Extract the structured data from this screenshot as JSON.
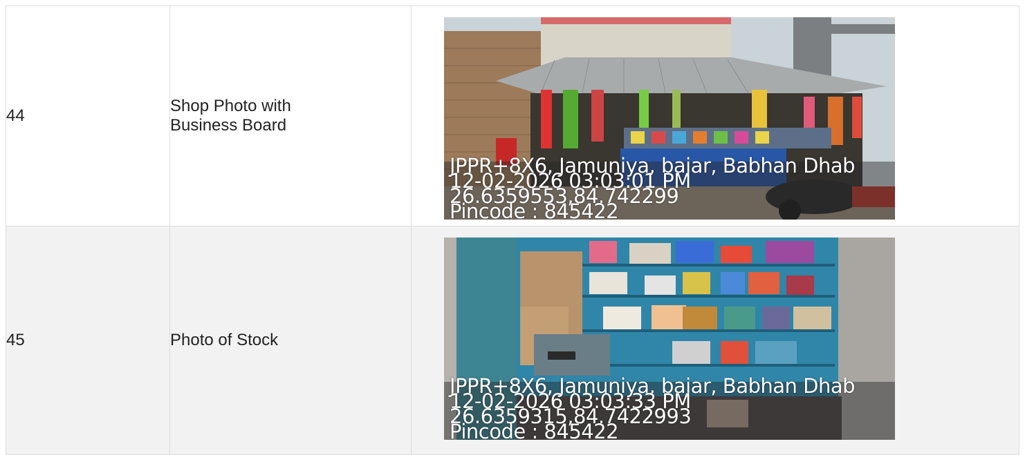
{
  "rows": [
    {
      "number": "44",
      "label": "Shop Photo with Business Board",
      "photo": {
        "icon": "shop-front-photo",
        "stamp": [
          "JPPR+8X6, Jamuniya, bajar, Babhan Dhab",
          "12-02-2026 03:03:01 PM",
          "26.6359553,84.742299",
          "Pincode : 845422"
        ]
      }
    },
    {
      "number": "45",
      "label": "Photo of Stock",
      "photo": {
        "icon": "shop-stock-photo",
        "stamp": [
          "JPPR+8X6, Jamuniya, bajar, Babhan Dhab",
          "12-02-2026 03:03:33 PM",
          "26.6359315,84.7422993",
          "Pincode : 845422"
        ]
      }
    }
  ]
}
